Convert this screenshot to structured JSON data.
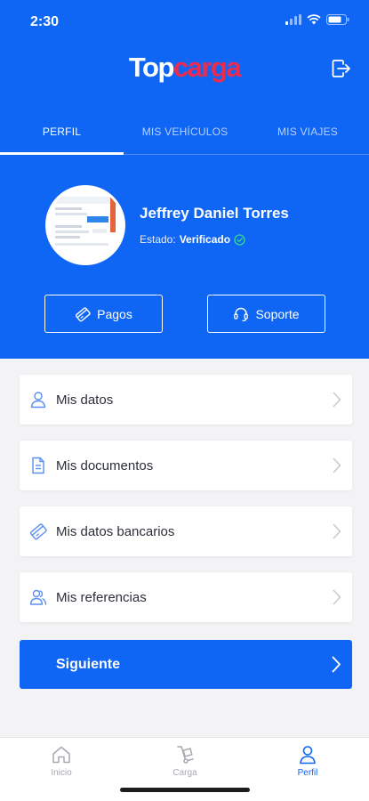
{
  "status_bar": {
    "time": "2:30"
  },
  "app": {
    "logo_primary": "Top",
    "logo_secondary": "carga"
  },
  "tabs": [
    {
      "label": "PERFIL",
      "active": true
    },
    {
      "label": "MIS VEHÍCULOS",
      "active": false
    },
    {
      "label": "MIS VIAJES",
      "active": false
    }
  ],
  "profile": {
    "name": "Jeffrey Daniel Torres",
    "status_label": "Estado:",
    "status_value": "Verificado"
  },
  "header_buttons": {
    "pagos": {
      "label": "Pagos",
      "icon": "card-icon"
    },
    "soporte": {
      "label": "Soporte",
      "icon": "headset-icon"
    }
  },
  "menu": [
    {
      "label": "Mis datos",
      "icon": "user-icon"
    },
    {
      "label": "Mis documentos",
      "icon": "document-icon"
    },
    {
      "label": "Mis datos bancarios",
      "icon": "card-icon"
    },
    {
      "label": "Mis referencias",
      "icon": "users-icon"
    }
  ],
  "next_button": {
    "label": "Siguiente"
  },
  "bottom_nav": [
    {
      "label": "Inicio",
      "icon": "home-icon",
      "active": false
    },
    {
      "label": "Carga",
      "icon": "cargo-icon",
      "active": false
    },
    {
      "label": "Perfil",
      "icon": "profile-icon",
      "active": true
    }
  ],
  "colors": {
    "primary": "#0f66f5",
    "logo_accent": "#ec2b4f",
    "verified": "#35d59a",
    "background": "#f3f3f5"
  }
}
